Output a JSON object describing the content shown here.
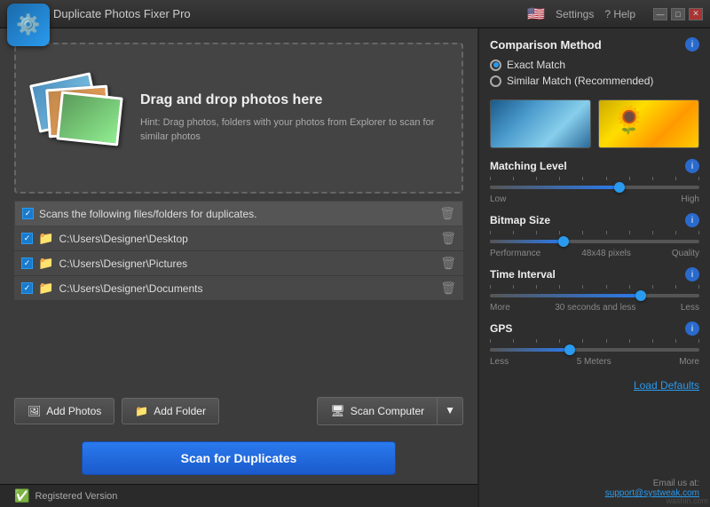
{
  "titlebar": {
    "title": "Duplicate Photos Fixer Pro",
    "settings_label": "Settings",
    "help_label": "? Help",
    "minimize_label": "—",
    "maximize_label": "□",
    "close_label": "✕"
  },
  "drop_zone": {
    "heading": "Drag and drop photos here",
    "hint": "Hint: Drag photos, folders with your photos from Explorer to scan for similar photos"
  },
  "folder_list": {
    "header": "Scans the following files/folders for duplicates.",
    "folders": [
      {
        "path": "C:\\Users\\Designer\\Desktop"
      },
      {
        "path": "C:\\Users\\Designer\\Pictures"
      },
      {
        "path": "C:\\Users\\Designer\\Documents"
      }
    ]
  },
  "buttons": {
    "add_photos": "Add Photos",
    "add_folder": "Add Folder",
    "scan_computer": "Scan Computer",
    "scan_duplicates": "Scan for Duplicates"
  },
  "status": {
    "label": "Registered Version"
  },
  "right_panel": {
    "comparison_method": {
      "title": "Comparison Method",
      "exact_match": "Exact Match",
      "similar_match": "Similar Match (Recommended)"
    },
    "matching_level": {
      "title": "Matching Level",
      "low": "Low",
      "high": "High",
      "value": 62
    },
    "bitmap_size": {
      "title": "Bitmap Size",
      "performance": "Performance",
      "quality": "Quality",
      "label": "48x48 pixels",
      "value": 35
    },
    "time_interval": {
      "title": "Time Interval",
      "more": "More",
      "less": "Less",
      "label": "30 seconds and less",
      "value": 72
    },
    "gps": {
      "title": "GPS",
      "less": "Less",
      "more": "More",
      "label": "5 Meters",
      "value": 38
    },
    "load_defaults": "Load Defaults"
  },
  "email": {
    "label": "Email us at:",
    "address": "support@systweak.com"
  },
  "watermark": "washin.com"
}
